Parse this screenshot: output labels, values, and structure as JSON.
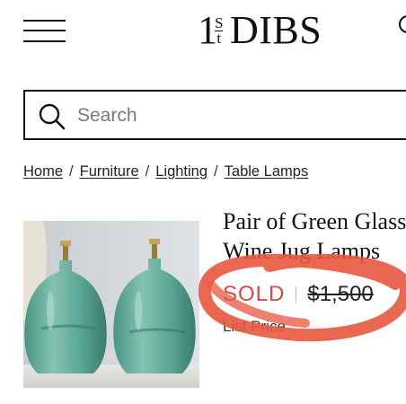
{
  "header": {
    "logo_prefix": "1",
    "logo_sup_top": "S",
    "logo_sup_bottom": "t",
    "logo_brand": "DIBS"
  },
  "search": {
    "placeholder": "Search"
  },
  "breadcrumb": {
    "items": [
      {
        "label": "Home"
      },
      {
        "label": "Furniture"
      },
      {
        "label": "Lighting"
      },
      {
        "label": "Table Lamps"
      }
    ],
    "separator": "/"
  },
  "product": {
    "title_line1": "Pair of Green Glass",
    "title_line2": "Wine Jug Lamps",
    "status": "SOLD",
    "price": "$1,500",
    "price_note": "List Price"
  },
  "colors": {
    "sold": "#d14b42",
    "scribble": "#e8563f"
  }
}
